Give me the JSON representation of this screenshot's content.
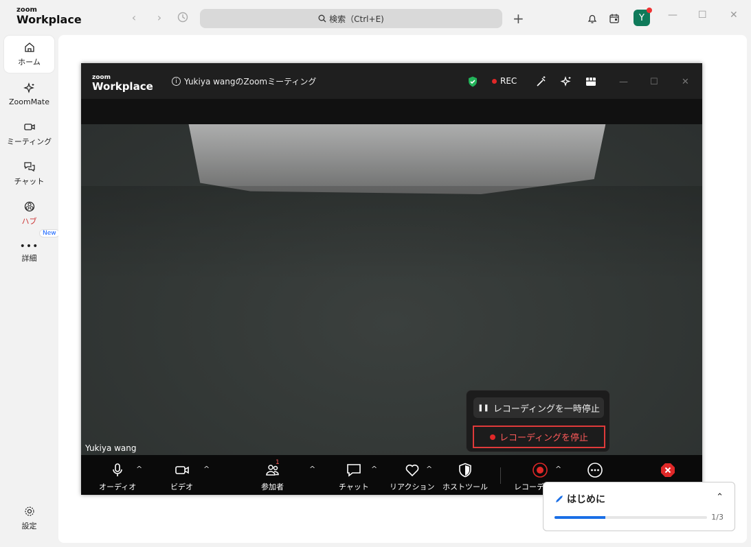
{
  "app": {
    "logo_line1": "zoom",
    "logo_line2": "Workplace"
  },
  "search": {
    "placeholder": "検索（Ctrl+E)"
  },
  "avatar": {
    "initial": "Y"
  },
  "sidebar": {
    "items": [
      {
        "label": "ホーム",
        "icon": "home-icon"
      },
      {
        "label": "ZoomMate",
        "icon": "sparkle-icon"
      },
      {
        "label": "ミーティング",
        "icon": "video-icon"
      },
      {
        "label": "チャット",
        "icon": "chat-icon"
      },
      {
        "label": "ハブ",
        "icon": "hub-icon"
      },
      {
        "label": "詳細",
        "icon": "more-icon",
        "badge": "New"
      }
    ],
    "settings_label": "設定"
  },
  "meeting": {
    "logo_line1": "zoom",
    "logo_line2": "Workplace",
    "title": "Yukiya wangのZoomミーティング",
    "rec_label": "REC",
    "participant_name": "Yukiya wang",
    "rec_menu": {
      "pause_label": "レコーディングを一時停止",
      "stop_label": "レコーディングを停止"
    },
    "toolbar": {
      "audio": "オーディオ",
      "video": "ビデオ",
      "participants": "参加者",
      "participants_count": "1",
      "chat": "チャット",
      "reactions": "リアクション",
      "host_tools": "ホストツール",
      "recording": "レコーディング",
      "more": "詳細",
      "end": "終了"
    }
  },
  "getting_started": {
    "title": "はじめに",
    "progress_text": "1/3",
    "progress_fraction": 0.333
  },
  "colors": {
    "accent": "#0b5cff",
    "record_red": "#e02828",
    "avatar_green": "#0f7a5a"
  }
}
